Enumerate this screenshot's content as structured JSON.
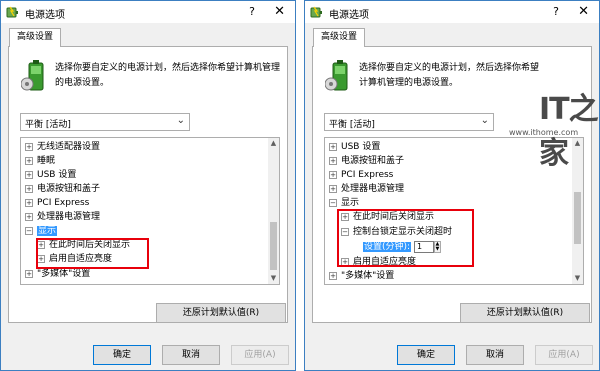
{
  "window": {
    "title": "电源选项",
    "help": "?",
    "close": "✕"
  },
  "tab": "高级设置",
  "description": "选择你要自定义的电源计划，然后选择你希望计算机管理的电源设置。",
  "plan_select": {
    "value": "平衡 [活动]"
  },
  "left_tree": [
    {
      "label": "无线适配器设置",
      "expander": "+"
    },
    {
      "label": "睡眠",
      "expander": "+"
    },
    {
      "label": "USB 设置",
      "expander": "+"
    },
    {
      "label": "电源按钮和盖子",
      "expander": "+"
    },
    {
      "label": "PCI Express",
      "expander": "+"
    },
    {
      "label": "处理器电源管理",
      "expander": "+"
    },
    {
      "label": "显示",
      "expander": "−",
      "selected": true
    },
    {
      "label": "在此时间后关闭显示",
      "expander": "+"
    },
    {
      "label": "启用自适应亮度",
      "expander": "+"
    },
    {
      "label": "\"多媒体\"设置",
      "expander": "+"
    }
  ],
  "right_tree": [
    {
      "label": "USB 设置",
      "expander": "+"
    },
    {
      "label": "电源按钮和盖子",
      "expander": "+"
    },
    {
      "label": "PCI Express",
      "expander": "+"
    },
    {
      "label": "处理器电源管理",
      "expander": "+"
    },
    {
      "label": "显示",
      "expander": "−"
    },
    {
      "label": "在此时间后关闭显示",
      "expander": "+"
    },
    {
      "label": "控制台锁定显示关闭超时",
      "expander": "−"
    },
    {
      "label": "设置(分钟):",
      "value": "1"
    },
    {
      "label": "启用自适应亮度",
      "expander": "+"
    },
    {
      "label": "\"多媒体\"设置",
      "expander": "+"
    }
  ],
  "buttons": {
    "restore": "还原计划默认值(R)",
    "ok": "确定",
    "cancel": "取消",
    "apply": "应用(A)"
  },
  "watermark": {
    "logo": "IT之家",
    "url": "www.ithome.com"
  },
  "colors": {
    "highlight": "#e8000b",
    "selection": "#3399ff",
    "border": "#3c7fc1"
  }
}
